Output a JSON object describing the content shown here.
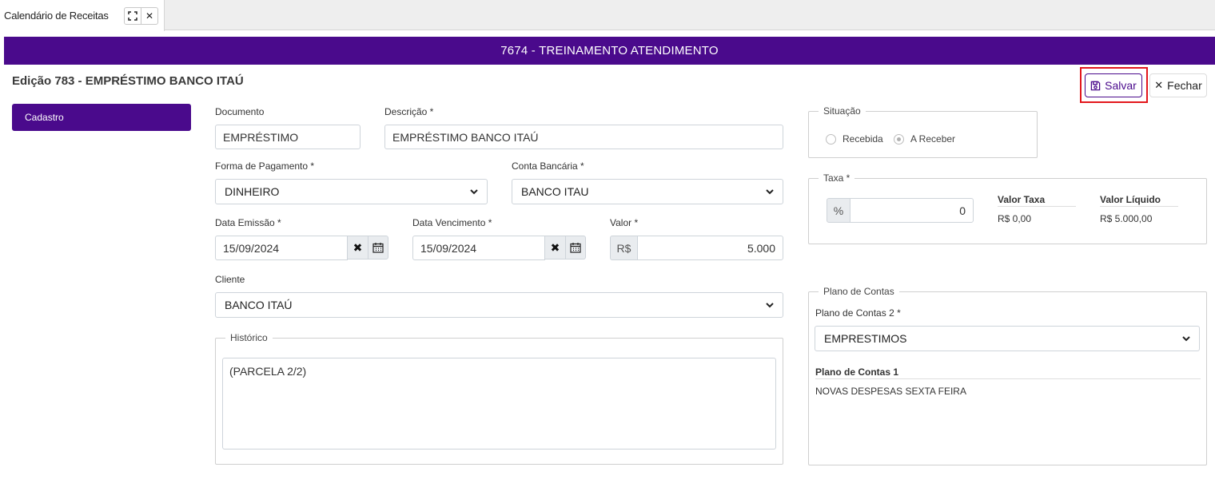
{
  "tab": {
    "title": "Calendário de Receitas"
  },
  "banner": {
    "title": "7674 - TREINAMENTO ATENDIMENTO"
  },
  "page": {
    "title": "Edição 783 - EMPRÉSTIMO BANCO ITAÚ"
  },
  "actions": {
    "save_label": "Salvar",
    "close_label": "Fechar"
  },
  "sidebar": {
    "items": [
      {
        "label": "Cadastro"
      }
    ]
  },
  "form": {
    "documento": {
      "label": "Documento",
      "value": "EMPRÉSTIMO"
    },
    "descricao": {
      "label": "Descrição *",
      "value": "EMPRÉSTIMO BANCO ITAÚ"
    },
    "forma_pagamento": {
      "label": "Forma de Pagamento *",
      "value": "DINHEIRO"
    },
    "conta_bancaria": {
      "label": "Conta Bancária *",
      "value": "BANCO ITAU"
    },
    "data_emissao": {
      "label": "Data Emissão *",
      "value": "15/09/2024"
    },
    "data_vencimento": {
      "label": "Data Vencimento *",
      "value": "15/09/2024"
    },
    "valor": {
      "label": "Valor *",
      "prefix": "R$",
      "value": "5.000"
    },
    "cliente": {
      "label": "Cliente",
      "value": "BANCO ITAÚ"
    },
    "historico": {
      "legend": "Histórico",
      "value": "(PARCELA 2/2)"
    }
  },
  "situacao": {
    "legend": "Situação",
    "options": [
      {
        "label": "Recebida",
        "checked": false
      },
      {
        "label": "A Receber",
        "checked": true
      }
    ]
  },
  "taxa": {
    "legend": "Taxa *",
    "prefix": "%",
    "value": "0",
    "valor_taxa": {
      "header": "Valor Taxa",
      "value": "R$ 0,00"
    },
    "valor_liquido": {
      "header": "Valor Líquido",
      "value": "R$ 5.000,00"
    }
  },
  "plano_contas": {
    "legend": "Plano de Contas",
    "nivel2": {
      "label": "Plano de Contas 2 *",
      "value": "EMPRESTIMOS"
    },
    "nivel1": {
      "header": "Plano de Contas 1",
      "value": "NOVAS DESPESAS SEXTA FEIRA"
    }
  },
  "icons": {
    "expand": "expand-icon",
    "close": "close-icon",
    "save": "floppy-disk-icon",
    "chevron": "chevron-down-icon",
    "calendar": "calendar-icon",
    "clear": "clear-x-icon"
  },
  "colors": {
    "brand": "#4a0a8c",
    "highlight": "#e3161c"
  }
}
